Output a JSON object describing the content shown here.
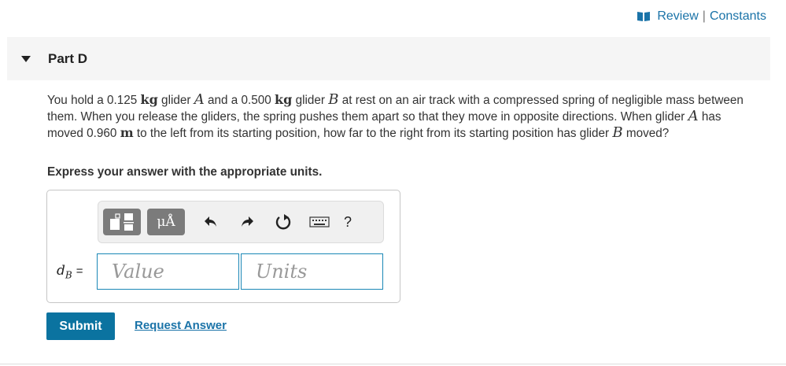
{
  "topbar": {
    "review_label": "Review",
    "separator": "|",
    "constants_label": "Constants",
    "icon": "book-icon"
  },
  "part": {
    "title": "Part D",
    "toggle_icon": "caret-down-icon"
  },
  "question": {
    "t1": "You hold a 0.125 ",
    "u1": "kg",
    "t2": " glider ",
    "a1": "A",
    "t3": " and a 0.500 ",
    "u2": "kg",
    "t4": " glider ",
    "b1": "B",
    "t5": " at rest on an air track with a compressed spring of negligible mass between them. When you release the gliders, the spring pushes them apart so that they move in opposite directions. When glider ",
    "a2": "A",
    "t6": " has moved 0.960 ",
    "u3": "m",
    "t7": " to the left from its starting position, how far to the right from its starting position has glider ",
    "b2": "B",
    "t8": " moved?"
  },
  "instruction": "Express your answer with the appropriate units.",
  "toolbar": {
    "units_button_label": "μÅ",
    "help_label": "?",
    "icons": [
      "templates-icon",
      "units-icon",
      "undo-icon",
      "redo-icon",
      "reset-icon",
      "keyboard-icon",
      "help-icon"
    ]
  },
  "answer": {
    "var_name": "d",
    "var_sub": "B",
    "equals": "=",
    "value_placeholder": "Value",
    "units_placeholder": "Units"
  },
  "actions": {
    "submit_label": "Submit",
    "request_label": "Request Answer"
  },
  "colors": {
    "accent": "#0b73a0",
    "link": "#1a73a8",
    "field_border": "#1a87b6",
    "toolbar_button": "#7b7b7b"
  }
}
